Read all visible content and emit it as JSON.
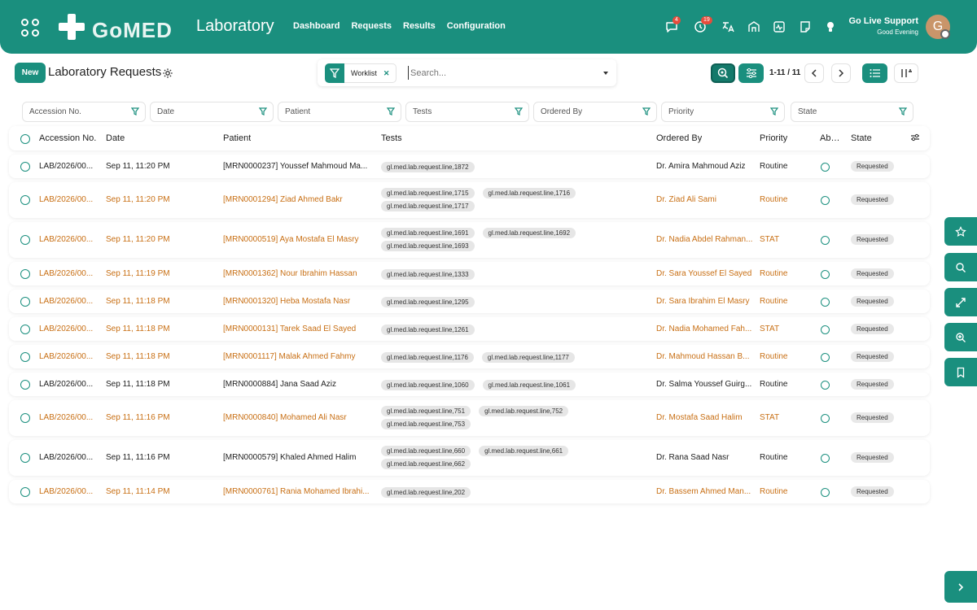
{
  "app": {
    "logo_text": "GoMED",
    "title": "Laboratory",
    "nav": [
      "Dashboard",
      "Requests",
      "Results",
      "Configuration"
    ]
  },
  "topbar_icons": [
    {
      "name": "chat-icon",
      "badge": "4"
    },
    {
      "name": "activity-clock-icon",
      "badge": "19"
    },
    {
      "name": "translate-icon",
      "badge": ""
    },
    {
      "name": "hospital-icon",
      "badge": ""
    },
    {
      "name": "monitor-pulse-icon",
      "badge": ""
    },
    {
      "name": "notes-icon",
      "badge": ""
    },
    {
      "name": "lightbulb-icon",
      "badge": ""
    }
  ],
  "user": {
    "support_label": "Go Live Support",
    "greeting": "Good Evening",
    "avatar_letter": "G"
  },
  "page": {
    "new_button": "New",
    "title": "Laboratory Requests"
  },
  "search": {
    "facet_label": "Worklist",
    "placeholder": "Search..."
  },
  "pager": {
    "range": "1-11 / 11"
  },
  "filters": [
    "Accession No.",
    "Date",
    "Patient",
    "Tests",
    "Ordered By",
    "Priority",
    "State"
  ],
  "columns": {
    "accession": "Accession No.",
    "date": "Date",
    "patient": "Patient",
    "tests": "Tests",
    "ordered_by": "Ordered By",
    "priority": "Priority",
    "abnormal": "Abnormal",
    "state": "State"
  },
  "rows": [
    {
      "accession": "LAB/2026/00...",
      "date": "Sep 11, 11:20 PM",
      "patient": "[MRN0000237] Youssef Mahmoud Ma...",
      "tests": [
        "gl.med.lab.request.line,1872"
      ],
      "ordered_by": "Dr. Amira Mahmoud Aziz",
      "priority": "Routine",
      "state": "Requested",
      "highlight": false
    },
    {
      "accession": "LAB/2026/00...",
      "date": "Sep 11, 11:20 PM",
      "patient": "[MRN0001294] Ziad Ahmed Bakr",
      "tests": [
        "gl.med.lab.request.line,1715",
        "gl.med.lab.request.line,1716",
        "gl.med.lab.request.line,1717"
      ],
      "ordered_by": "Dr. Ziad Ali Sami",
      "priority": "Routine",
      "state": "Requested",
      "highlight": true
    },
    {
      "accession": "LAB/2026/00...",
      "date": "Sep 11, 11:20 PM",
      "patient": "[MRN0000519] Aya Mostafa El Masry",
      "tests": [
        "gl.med.lab.request.line,1691",
        "gl.med.lab.request.line,1692",
        "gl.med.lab.request.line,1693"
      ],
      "ordered_by": "Dr. Nadia Abdel Rahman...",
      "priority": "STAT",
      "state": "Requested",
      "highlight": true
    },
    {
      "accession": "LAB/2026/00...",
      "date": "Sep 11, 11:19 PM",
      "patient": "[MRN0001362] Nour Ibrahim Hassan",
      "tests": [
        "gl.med.lab.request.line,1333"
      ],
      "ordered_by": "Dr. Sara Youssef El Sayed",
      "priority": "Routine",
      "state": "Requested",
      "highlight": true
    },
    {
      "accession": "LAB/2026/00...",
      "date": "Sep 11, 11:18 PM",
      "patient": "[MRN0001320] Heba Mostafa Nasr",
      "tests": [
        "gl.med.lab.request.line,1295"
      ],
      "ordered_by": "Dr. Sara Ibrahim El Masry",
      "priority": "Routine",
      "state": "Requested",
      "highlight": true
    },
    {
      "accession": "LAB/2026/00...",
      "date": "Sep 11, 11:18 PM",
      "patient": "[MRN0000131] Tarek Saad El Sayed",
      "tests": [
        "gl.med.lab.request.line,1261"
      ],
      "ordered_by": "Dr. Nadia Mohamed Fah...",
      "priority": "STAT",
      "state": "Requested",
      "highlight": true
    },
    {
      "accession": "LAB/2026/00...",
      "date": "Sep 11, 11:18 PM",
      "patient": "[MRN0001117] Malak Ahmed Fahmy",
      "tests": [
        "gl.med.lab.request.line,1176",
        "gl.med.lab.request.line,1177"
      ],
      "ordered_by": "Dr. Mahmoud Hassan B...",
      "priority": "Routine",
      "state": "Requested",
      "highlight": true
    },
    {
      "accession": "LAB/2026/00...",
      "date": "Sep 11, 11:18 PM",
      "patient": "[MRN0000884] Jana Saad Aziz",
      "tests": [
        "gl.med.lab.request.line,1060",
        "gl.med.lab.request.line,1061"
      ],
      "ordered_by": "Dr. Salma Youssef Guirg...",
      "priority": "Routine",
      "state": "Requested",
      "highlight": false
    },
    {
      "accession": "LAB/2026/00...",
      "date": "Sep 11, 11:16 PM",
      "patient": "[MRN0000840] Mohamed Ali Nasr",
      "tests": [
        "gl.med.lab.request.line,751",
        "gl.med.lab.request.line,752",
        "gl.med.lab.request.line,753"
      ],
      "ordered_by": "Dr. Mostafa Saad Halim",
      "priority": "STAT",
      "state": "Requested",
      "highlight": true
    },
    {
      "accession": "LAB/2026/00...",
      "date": "Sep 11, 11:16 PM",
      "patient": "[MRN0000579] Khaled Ahmed Halim",
      "tests": [
        "gl.med.lab.request.line,660",
        "gl.med.lab.request.line,661",
        "gl.med.lab.request.line,662"
      ],
      "ordered_by": "Dr. Rana Saad Nasr",
      "priority": "Routine",
      "state": "Requested",
      "highlight": false
    },
    {
      "accession": "LAB/2026/00...",
      "date": "Sep 11, 11:14 PM",
      "patient": "[MRN0000761] Rania Mohamed Ibrahi...",
      "tests": [
        "gl.med.lab.request.line,202"
      ],
      "ordered_by": "Dr. Bassem Ahmed Man...",
      "priority": "Routine",
      "state": "Requested",
      "highlight": true
    }
  ],
  "side_tools": [
    "star-icon",
    "search-icon",
    "expand-icon",
    "zoom-in-icon",
    "bookmark-icon"
  ],
  "colors": {
    "brand": "#1a8f7e",
    "highlight_text": "#c86f14"
  }
}
